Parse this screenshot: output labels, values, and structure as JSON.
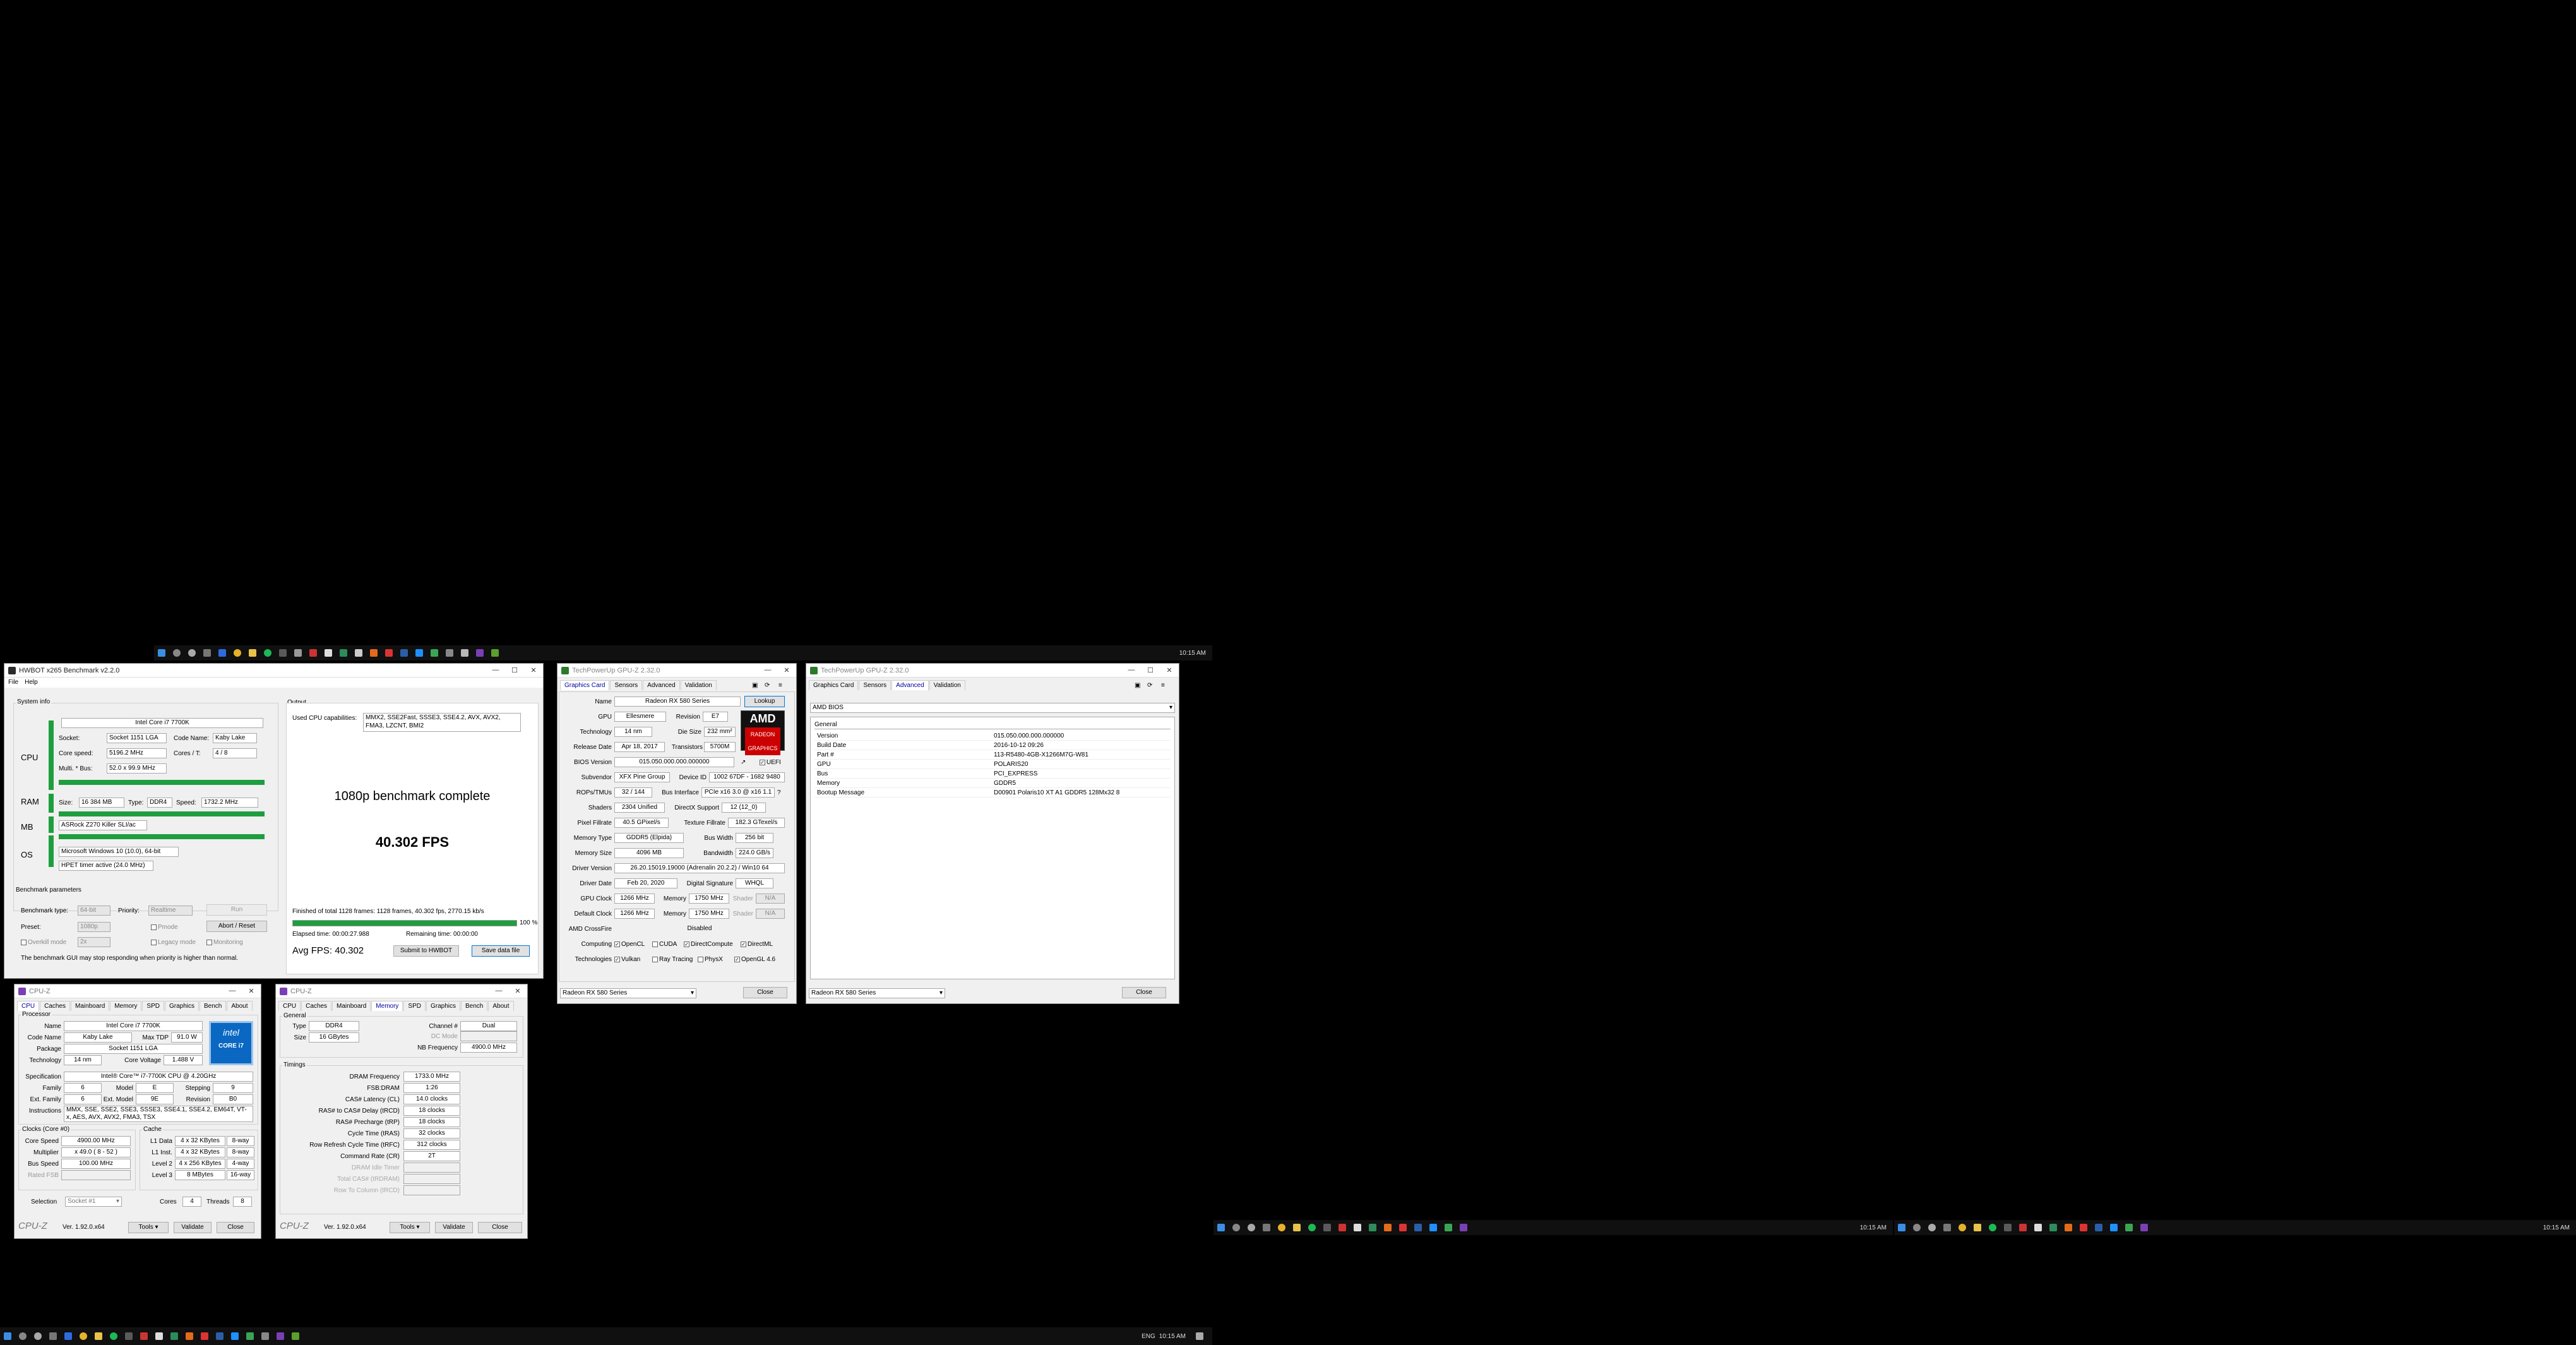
{
  "taskbars": {
    "main_clock": "10:15 AM",
    "main_tray_lang": "ENG",
    "top_clock": "10:15 AM",
    "right1_clock": "10:15 AM",
    "right2_clock": "10:15 AM"
  },
  "hwbot": {
    "title": "HWBOT x265 Benchmark v2.2.0",
    "menu": [
      "File",
      "Help"
    ],
    "system_info_label": "System info",
    "output_label": "Output",
    "cpu_label": "CPU",
    "ram_label": "RAM",
    "mb_label": "MB",
    "os_label": "OS",
    "cpu_name": "Intel Core i7 7700K",
    "socket_label": "Socket:",
    "socket": "Socket 1151 LGA",
    "codename_label": "Code Name:",
    "codename": "Kaby Lake",
    "core_speed_label": "Core speed:",
    "core_speed": "5196.2 MHz",
    "cores_label": "Cores / T:",
    "cores": "4 / 8",
    "mult_label": "Multi. * Bus:",
    "mult": "52.0 x 99.9 MHz",
    "ram_size_label": "Size:",
    "ram_size": "16 384 MB",
    "ram_type_label": "Type:",
    "ram_type": "DDR4",
    "ram_speed_label": "Speed:",
    "ram_speed": "1732.2 MHz",
    "mb_name": "ASRock Z270 Killer SLI/ac",
    "os_name": "Microsoft Windows 10 (10.0), 64-bit",
    "timer": "HPET timer active (24.0 MHz)",
    "used_caps_label": "Used CPU capabilities:",
    "used_caps": "MMX2, SSE2Fast, SSSE3, SSE4.2, AVX, AVX2, FMA3, LZCNT, BMI2",
    "bench_complete": "1080p benchmark complete",
    "fps_big": "40.302 FPS",
    "finished_text": "Finished of total 1128 frames: 1128 frames, 40.302 fps, 2770.15 kb/s",
    "progress_pct": 100,
    "progress_label": "100 %",
    "elapsed": "Elapsed time: 00:00:27.988",
    "remaining": "Remaining time: 00:00:00",
    "avg_fps": "Avg FPS: 40.302",
    "submit_btn": "Submit to HWBOT",
    "save_btn": "Save data file",
    "params_label": "Benchmark parameters",
    "bench_type_label": "Benchmark type:",
    "bench_type": "64-bit",
    "priority_label": "Priority:",
    "priority": "Realtime",
    "run_btn": "Run",
    "preset_label": "Preset:",
    "preset": "1080p",
    "pmode_label": "Pmode",
    "abort_btn": "Abort / Reset",
    "overkill_label": "Overkill mode",
    "overkill_val": "2x",
    "legacy_label": "Legacy mode",
    "monitoring_label": "Monitoring",
    "warning": "The benchmark GUI may stop responding when priority is higher than normal."
  },
  "gpuz1": {
    "title": "TechPowerUp GPU-Z 2.32.0",
    "tabs": [
      "Graphics Card",
      "Sensors",
      "Advanced",
      "Validation"
    ],
    "lookup_btn": "Lookup",
    "logo_text": "AMD",
    "logo_sub": "RADEON GRAPHICS",
    "name_label": "Name",
    "name": "Radeon RX 580 Series",
    "gpu_label": "GPU",
    "gpu": "Ellesmere",
    "revision_label": "Revision",
    "revision": "E7",
    "tech_label": "Technology",
    "tech": "14 nm",
    "die_label": "Die Size",
    "die": "232 mm²",
    "release_label": "Release Date",
    "release": "Apr 18, 2017",
    "transistors_label": "Transistors",
    "transistors": "5700M",
    "bios_label": "BIOS Version",
    "bios": "015.050.000.000.000000",
    "uefi_label": "UEFI",
    "subvendor_label": "Subvendor",
    "subvendor": "XFX Pine Group",
    "devid_label": "Device ID",
    "devid": "1002 67DF - 1682 9480",
    "rops_label": "ROPs/TMUs",
    "rops": "32 / 144",
    "bus_label": "Bus Interface",
    "bus": "PCIe x16 3.0 @ x16 1.1",
    "shaders_label": "Shaders",
    "shaders": "2304 Unified",
    "dx_label": "DirectX Support",
    "dx": "12 (12_0)",
    "pixel_label": "Pixel Fillrate",
    "pixel": "40.5 GPixel/s",
    "texture_label": "Texture Fillrate",
    "texture": "182.3 GTexel/s",
    "memtype_label": "Memory Type",
    "memtype": "GDDR5 (Elpida)",
    "buswidth_label": "Bus Width",
    "buswidth": "256 bit",
    "memsize_label": "Memory Size",
    "memsize": "4096 MB",
    "bandwidth_label": "Bandwidth",
    "bandwidth": "224.0 GB/s",
    "driver_label": "Driver Version",
    "driver": "26.20.15019.19000 (Adrenalin 20.2.2) / Win10 64",
    "driverdate_label": "Driver Date",
    "driverdate": "Feb 20, 2020",
    "digsig_label": "Digital Signature",
    "digsig": "WHQL",
    "gpuclock_label": "GPU Clock",
    "gpuclock": "1266 MHz",
    "mem_label": "Memory",
    "memclock": "1750 MHz",
    "shader_label": "Shader",
    "shader_na": "N/A",
    "defclock_label": "Default Clock",
    "defclock": "1266 MHz",
    "defmem": "1750 MHz",
    "crossfire_label": "AMD CrossFire",
    "crossfire": "Disabled",
    "computing_label": "Computing",
    "computing": [
      "OpenCL",
      "CUDA",
      "DirectCompute",
      "DirectML"
    ],
    "techs_label": "Technologies",
    "techs": [
      "Vulkan",
      "Ray Tracing",
      "PhysX",
      "OpenGL 4.6"
    ],
    "select": "Radeon RX 580 Series",
    "close_btn": "Close"
  },
  "gpuz2": {
    "title": "TechPowerUp GPU-Z 2.32.0",
    "tabs": [
      "Graphics Card",
      "Sensors",
      "Advanced",
      "Validation"
    ],
    "dropdown": "AMD BIOS",
    "section": "General",
    "rows": [
      {
        "k": "Version",
        "v": "015.050.000.000.000000"
      },
      {
        "k": "Build Date",
        "v": "2016-10-12 09:26"
      },
      {
        "k": "Part #",
        "v": "113-R5480-4GB-X1266M7G-W81"
      },
      {
        "k": "GPU",
        "v": "POLARIS20"
      },
      {
        "k": "Bus",
        "v": "PCI_EXPRESS"
      },
      {
        "k": "Memory",
        "v": "GDDR5"
      },
      {
        "k": "Bootup Message",
        "v": "D00901 Polaris10 XT A1 GDDR5 128Mx32 8"
      }
    ],
    "select": "Radeon RX 580 Series",
    "close_btn": "Close"
  },
  "cpuz1": {
    "title": "CPU-Z",
    "tabs": [
      "CPU",
      "Caches",
      "Mainboard",
      "Memory",
      "SPD",
      "Graphics",
      "Bench",
      "About"
    ],
    "processor_grp": "Processor",
    "name_label": "Name",
    "name": "Intel Core i7 7700K",
    "codename_label": "Code Name",
    "codename": "Kaby Lake",
    "maxtdp_label": "Max TDP",
    "maxtdp": "91.0 W",
    "package_label": "Package",
    "package": "Socket 1151 LGA",
    "tech_label": "Technology",
    "tech": "14 nm",
    "voltage_label": "Core Voltage",
    "voltage": "1.488 V",
    "spec_label": "Specification",
    "spec": "Intel® Core™ i7-7700K CPU @ 4.20GHz",
    "family_label": "Family",
    "family": "6",
    "model_label": "Model",
    "model": "E",
    "stepping_label": "Stepping",
    "stepping": "9",
    "extfamily_label": "Ext. Family",
    "extfamily": "6",
    "extmodel_label": "Ext. Model",
    "extmodel": "9E",
    "revision_label": "Revision",
    "revision": "B0",
    "instr_label": "Instructions",
    "instr": "MMX, SSE, SSE2, SSE3, SSSE3, SSE4.1, SSE4.2, EM64T, VT-x, AES, AVX, AVX2, FMA3, TSX",
    "logo_text": "intel",
    "logo_sub": "CORE i7",
    "clocks_grp": "Clocks (Core #0)",
    "corespeed_label": "Core Speed",
    "corespeed": "4900.00 MHz",
    "multiplier_label": "Multiplier",
    "multiplier": "x 49.0 ( 8 - 52 )",
    "busspeed_label": "Bus Speed",
    "busspeed": "100.00 MHz",
    "ratedfsb_label": "Rated FSB",
    "cache_grp": "Cache",
    "l1d_label": "L1 Data",
    "l1d": "4 x 32 KBytes",
    "l1d_way": "8-way",
    "l1i_label": "L1 Inst.",
    "l1i": "4 x 32 KBytes",
    "l1i_way": "8-way",
    "l2_label": "Level 2",
    "l2": "4 x 256 KBytes",
    "l2_way": "4-way",
    "l3_label": "Level 3",
    "l3": "8 MBytes",
    "l3_way": "16-way",
    "selection_label": "Selection",
    "selection": "Socket #1",
    "cores_label": "Cores",
    "cores": "4",
    "threads_label": "Threads",
    "threads": "8",
    "brand": "CPU-Z",
    "version": "Ver. 1.92.0.x64",
    "tools_btn": "Tools",
    "validate_btn": "Validate",
    "close_btn": "Close"
  },
  "cpuz2": {
    "title": "CPU-Z",
    "tabs": [
      "CPU",
      "Caches",
      "Mainboard",
      "Memory",
      "SPD",
      "Graphics",
      "Bench",
      "About"
    ],
    "general_grp": "General",
    "type_label": "Type",
    "type": "DDR4",
    "channel_label": "Channel #",
    "channel": "Dual",
    "dcmode_label": "DC Mode",
    "size_label": "Size",
    "size": "16 GBytes",
    "nbfreq_label": "NB Frequency",
    "nbfreq": "4900.0 MHz",
    "timings_grp": "Timings",
    "timings": [
      {
        "k": "DRAM Frequency",
        "v": "1733.0 MHz"
      },
      {
        "k": "FSB:DRAM",
        "v": "1:26"
      },
      {
        "k": "CAS# Latency (CL)",
        "v": "14.0 clocks"
      },
      {
        "k": "RAS# to CAS# Delay (tRCD)",
        "v": "18 clocks"
      },
      {
        "k": "RAS# Precharge (tRP)",
        "v": "18 clocks"
      },
      {
        "k": "Cycle Time (tRAS)",
        "v": "32 clocks"
      },
      {
        "k": "Row Refresh Cycle Time (tRFC)",
        "v": "312 clocks"
      },
      {
        "k": "Command Rate (CR)",
        "v": "2T"
      },
      {
        "k": "DRAM Idle Timer",
        "v": ""
      },
      {
        "k": "Total CAS# (tRDRAM)",
        "v": ""
      },
      {
        "k": "Row To Column (tRCD)",
        "v": ""
      }
    ],
    "brand": "CPU-Z",
    "version": "Ver. 1.92.0.x64",
    "tools_btn": "Tools",
    "validate_btn": "Validate",
    "close_btn": "Close"
  },
  "colors": {
    "accent_green": "#1e9e3e",
    "amd_red": "#cc0000",
    "intel_blue": "#0a68c2"
  }
}
